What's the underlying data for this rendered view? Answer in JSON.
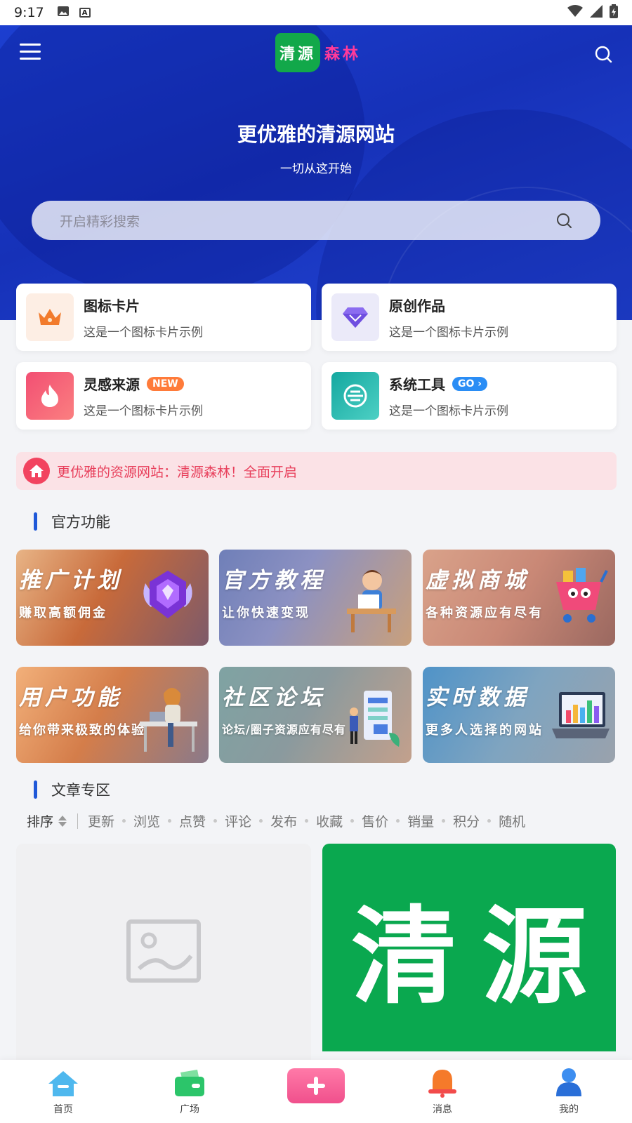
{
  "status_bar": {
    "time": "9:17"
  },
  "header": {
    "logo_left": "清源",
    "logo_right": "森林",
    "title": "更优雅的清源网站",
    "subtitle": "一切从这开始",
    "search_placeholder": "开启精彩搜索"
  },
  "cards": [
    {
      "title": "图标卡片",
      "desc": "这是一个图标卡片示例",
      "icon": "crown-icon",
      "badge": ""
    },
    {
      "title": "原创作品",
      "desc": "这是一个图标卡片示例",
      "icon": "diamond-icon",
      "badge": ""
    },
    {
      "title": "灵感来源",
      "desc": "这是一个图标卡片示例",
      "icon": "flame-icon",
      "badge": "NEW"
    },
    {
      "title": "系统工具",
      "desc": "这是一个图标卡片示例",
      "icon": "tool-icon",
      "badge": "GO"
    }
  ],
  "notice": {
    "text": "更优雅的资源网站：清源森林！全面开启"
  },
  "official": {
    "title": "官方功能",
    "tiles": [
      {
        "title": "推广计划",
        "subtitle": "赚取高额佣金"
      },
      {
        "title": "官方教程",
        "subtitle": "让你快速变现"
      },
      {
        "title": "虚拟商城",
        "subtitle": "各种资源应有尽有"
      },
      {
        "title": "用户功能",
        "subtitle": "给你带来极致的体验"
      },
      {
        "title": "社区论坛",
        "subtitle": "论坛/圈子资源应有尽有"
      },
      {
        "title": "实时数据",
        "subtitle": "更多人选择的网站"
      }
    ]
  },
  "articles": {
    "title": "文章专区",
    "sort_label": "排序",
    "sort_options": [
      "更新",
      "浏览",
      "点赞",
      "评论",
      "发布",
      "收藏",
      "售价",
      "销量",
      "积分",
      "随机"
    ],
    "card2_text": "清源"
  },
  "bottom_nav": [
    {
      "label": "首页",
      "icon": "home-icon"
    },
    {
      "label": "广场",
      "icon": "wallet-icon"
    },
    {
      "label": "",
      "icon": "plus-icon"
    },
    {
      "label": "消息",
      "icon": "bell-icon"
    },
    {
      "label": "我的",
      "icon": "user-icon"
    }
  ],
  "colors": {
    "hero_blue": "#1c3fd0",
    "accent_pink": "#f2435f",
    "brand_green": "#0aa84f",
    "new_badge": "#ff7b3a",
    "go_badge": "#2a8df5"
  }
}
